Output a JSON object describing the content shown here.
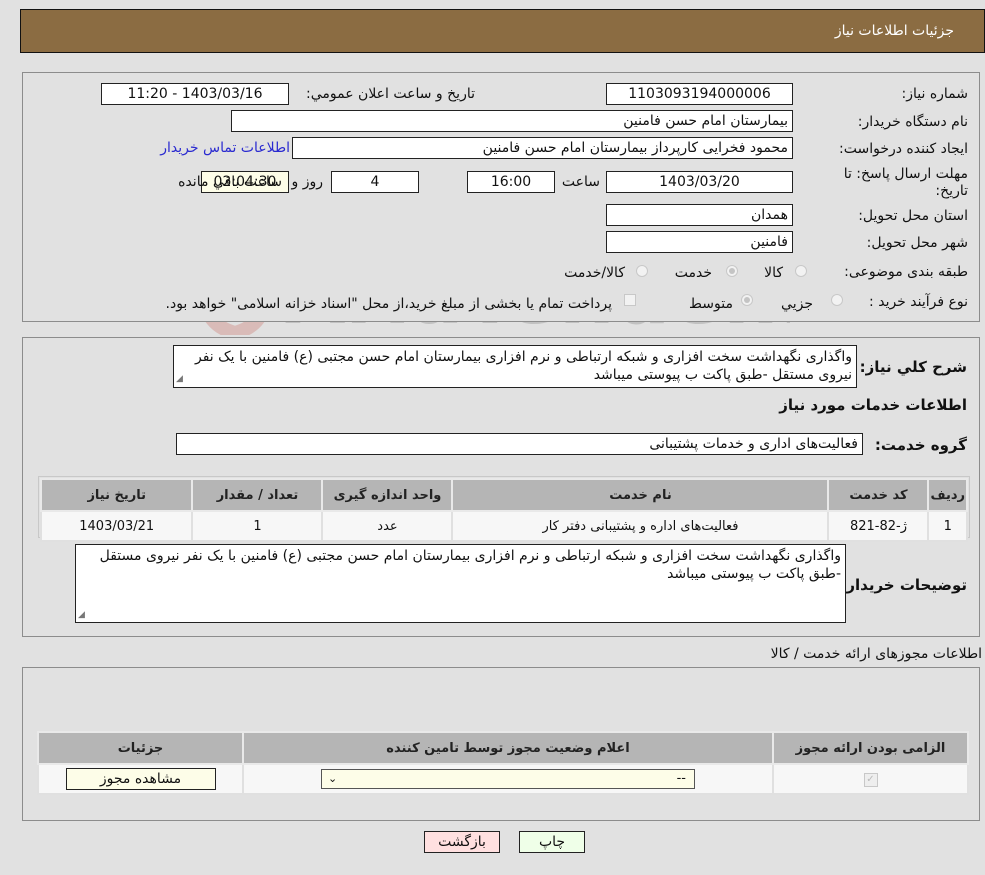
{
  "header": {
    "title": "جزئیات اطلاعات نیاز"
  },
  "form": {
    "need_number_label": "شماره نیاز:",
    "need_number": "1103093194000006",
    "announce_label": "تاريخ و ساعت اعلان عمومي:",
    "announce_value": "1403/03/16 - 11:20",
    "buyer_org_label": "نام دستگاه خريدار:",
    "buyer_org": "بيمارستان امام حسن فامنين",
    "creator_label": "ايجاد کننده درخواست:",
    "creator": "محمود فخرايی کارپرداز بيمارستان امام حسن فامنين",
    "contact_link": "اطلاعات تماس خريدار",
    "deadline_label_1": "مهلت ارسال پاسخ: تا",
    "deadline_label_2": "تاریخ:",
    "deadline_date": "1403/03/20",
    "time_label": "ساعت",
    "deadline_time": "16:00",
    "days_value": "4",
    "days_label": "روز و",
    "remaining_time": "02:04:30",
    "remaining_label": "ساعت باقي مانده",
    "province_label": "استان محل تحويل:",
    "province": "همدان",
    "city_label": "شهر محل تحويل:",
    "city": "فامنين",
    "category_label": "طبقه بندی موضوعی:",
    "category_options": [
      "کالا",
      "خدمت",
      "کالا/خدمت"
    ],
    "category_selected": "خدمت",
    "process_label": "نوع فرآيند خريد :",
    "process_options": [
      "جزيي",
      "متوسط"
    ],
    "process_selected": "متوسط",
    "treasury_text": "پرداخت تمام يا بخشی از مبلغ خريد،از محل \"اسناد خزانه اسلامی\" خواهد بود."
  },
  "description": {
    "label": "شرح کلي نياز:",
    "text": "واگذاری نگهداشت سخت افزاری و شبکه ارتباطی و نرم افزاری بيمارستان امام حسن مجتبی (ع) فامنين با يک نفر نيروی مستقل -طبق پاکت ب پيوستی ميباشد",
    "services_heading": "اطلاعات خدمات مورد نياز",
    "service_group_label": "گروه خدمت:",
    "service_group": "فعاليت‌های اداری و خدمات پشتيبانی"
  },
  "services_table": {
    "headers": [
      "رديف",
      "کد خدمت",
      "نام خدمت",
      "واحد اندازه گيری",
      "تعداد / مقدار",
      "تاريخ نياز"
    ],
    "rows": [
      [
        "1",
        "ژ-82-821",
        "فعاليت‌های اداره و پشتيبانی دفتر کار",
        "عدد",
        "1",
        "1403/03/21"
      ]
    ]
  },
  "buyer_notes": {
    "label": "توضيحات خريدار:",
    "text": "واگذاری نگهداشت سخت افزاری و شبکه ارتباطی و نرم افزاری بيمارستان امام حسن مجتبی (ع) فامنين با يک نفر نيروی مستقل -طبق پاکت ب پيوستی ميباشد"
  },
  "permits": {
    "heading": "اطلاعات مجوزهای ارائه خدمت / کالا",
    "headers": [
      "الزامی بودن ارائه مجوز",
      "اعلام وضعيت مجوز توسط تامين کننده",
      "جزئيات"
    ],
    "status_select": "--",
    "view_button": "مشاهده مجوز",
    "required_checked": true
  },
  "actions": {
    "print": "چاپ",
    "back": "بازگشت"
  },
  "watermark": {
    "text": "AriaTender.neT"
  }
}
